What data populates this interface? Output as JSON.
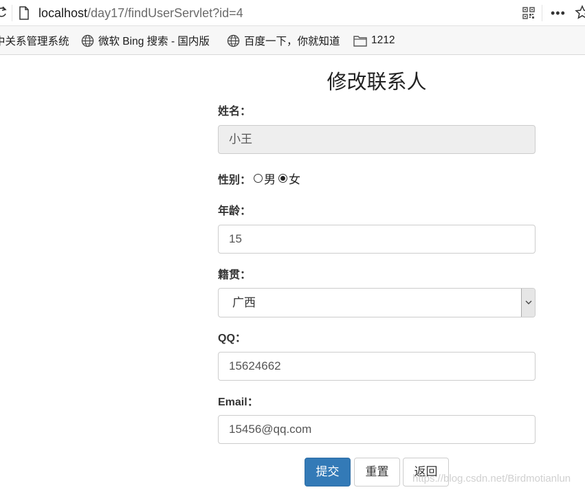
{
  "browser": {
    "url_host": "localhost",
    "url_path": "/day17/findUserServlet?id=4",
    "more_label": "•••"
  },
  "bookmarks": [
    {
      "label": "中关系管理系统",
      "icon": "none"
    },
    {
      "label": "微软 Bing 搜索 - 国内版",
      "icon": "globe-icon"
    },
    {
      "label": "百度一下，你就知道",
      "icon": "globe-icon"
    },
    {
      "label": "1212",
      "icon": "folder-icon"
    }
  ],
  "form": {
    "title": "修改联系人",
    "name_label": "姓名：",
    "name_value": "小王",
    "gender_label": "性别：",
    "gender_options": [
      "男",
      "女"
    ],
    "gender_selected": "女",
    "age_label": "年龄：",
    "age_value": "15",
    "hometown_label": "籍贯：",
    "hometown_value": "广西",
    "qq_label": "QQ：",
    "qq_value": "15624662",
    "email_label": "Email：",
    "email_value": "15456@qq.com",
    "submit_label": "提交",
    "reset_label": "重置",
    "back_label": "返回"
  },
  "watermark": "https://blog.csdn.net/Birdmotianlun",
  "colors": {
    "primary": "#337ab7",
    "readonly_bg": "#eeeeee",
    "border": "#cccccc"
  }
}
